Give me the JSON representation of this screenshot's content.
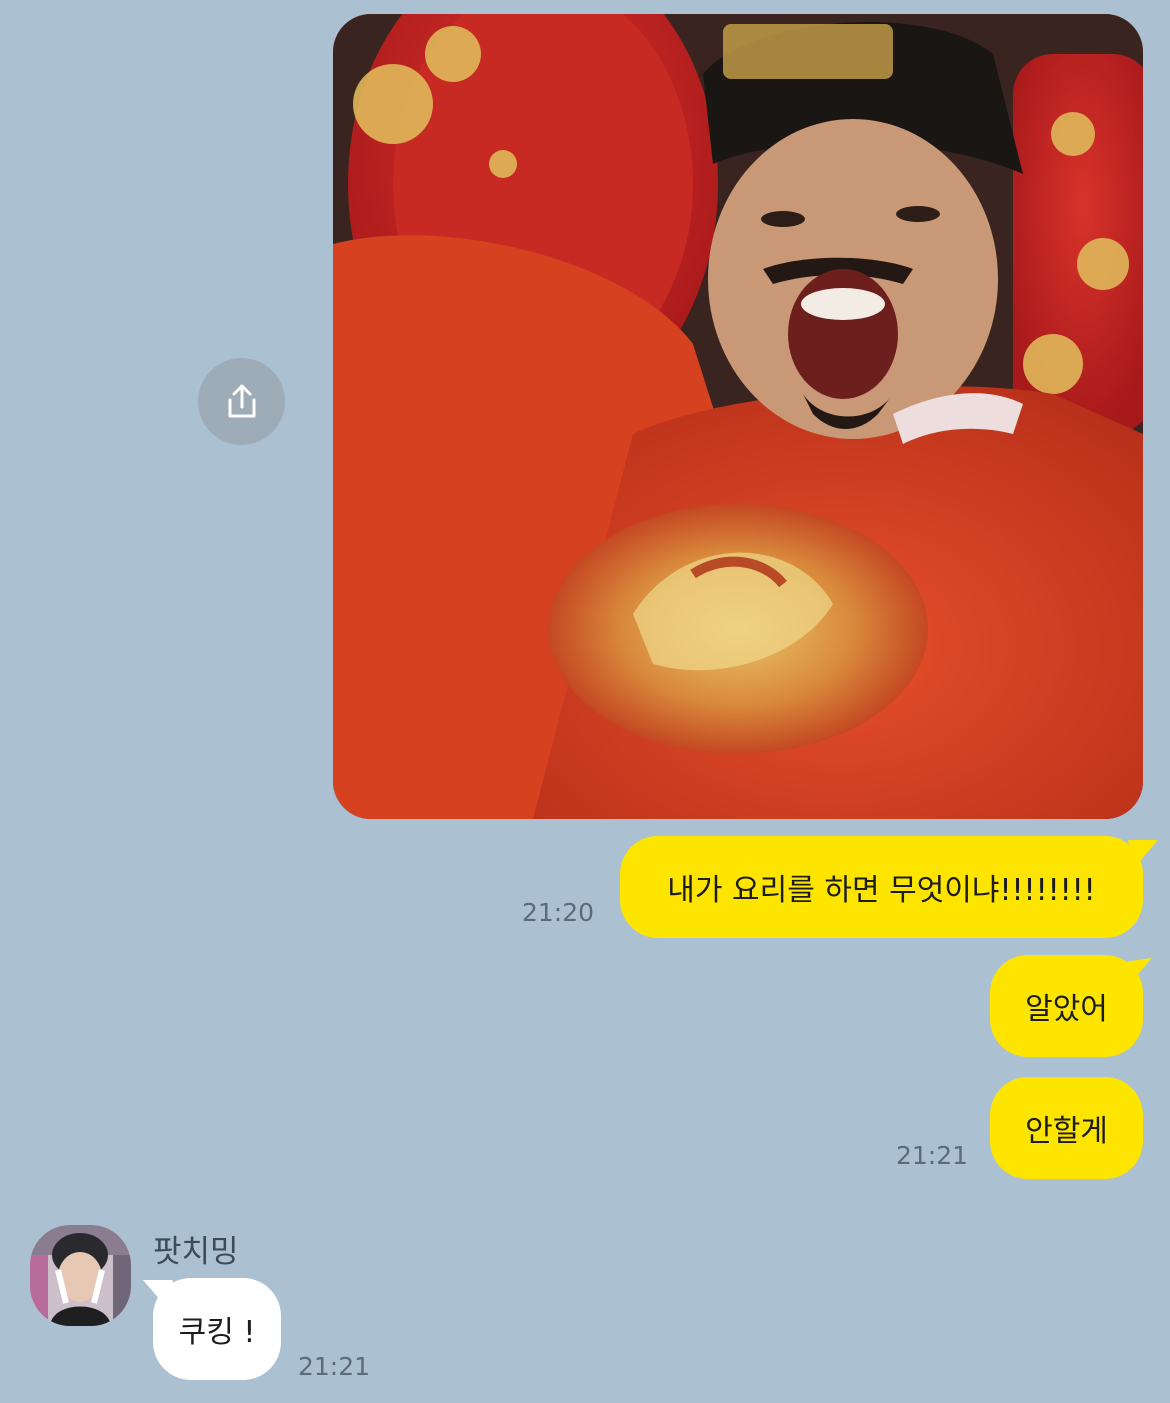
{
  "colors": {
    "background": "#abc1d1",
    "my_bubble": "#fee500",
    "other_bubble": "#ffffff",
    "timestamp": "#5d6b78"
  },
  "image_message": {
    "icon": "share-icon"
  },
  "messages": [
    {
      "from": "me",
      "text": "내가 요리를 하면 무엇이냐!!!!!!!!",
      "time": "21:20"
    },
    {
      "from": "me",
      "text": "알았어",
      "time": ""
    },
    {
      "from": "me",
      "text": "안할게",
      "time": "21:21"
    },
    {
      "from": "other",
      "sender": "팟치밍",
      "text": "쿠킹 !",
      "time": "21:21"
    }
  ]
}
